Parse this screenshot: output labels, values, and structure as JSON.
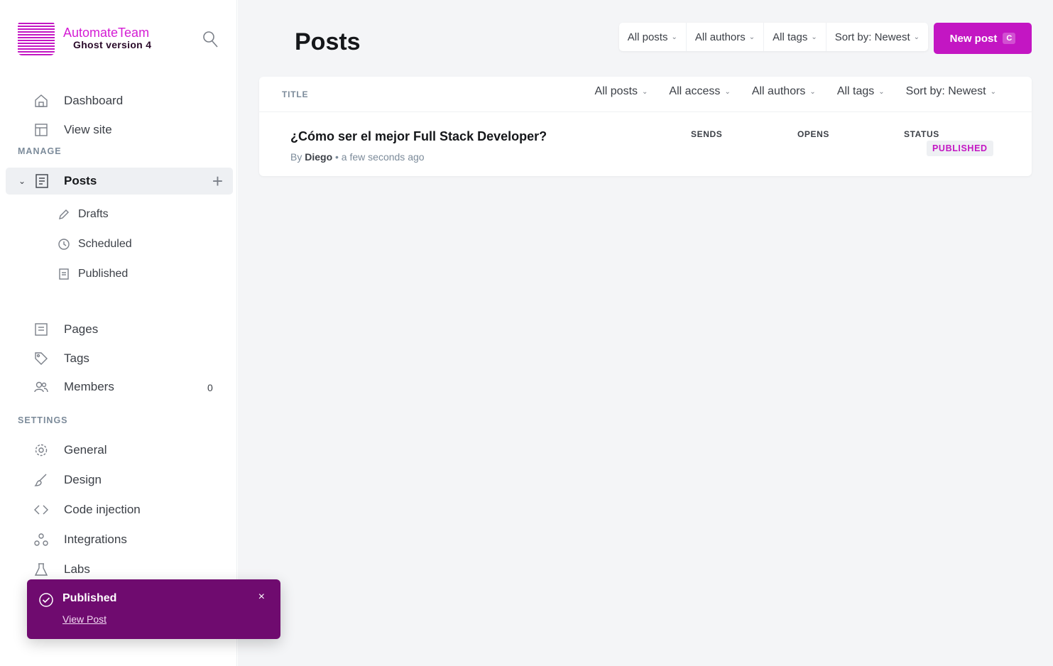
{
  "brand": {
    "name": "AutomateTeam",
    "version": "Ghost version 4"
  },
  "sidebar": {
    "nav_top": [
      {
        "label": "Dashboard",
        "icon": "home-icon"
      },
      {
        "label": "View site",
        "icon": "window-icon"
      }
    ],
    "manage_label": "MANAGE",
    "posts": {
      "label": "Posts",
      "icon": "posts-icon"
    },
    "post_subitems": [
      {
        "label": "Drafts",
        "icon": "pencil-icon"
      },
      {
        "label": "Scheduled",
        "icon": "clock-icon"
      },
      {
        "label": "Published",
        "icon": "published-icon"
      }
    ],
    "manage_items": [
      {
        "label": "Pages",
        "icon": "pages-icon"
      },
      {
        "label": "Tags",
        "icon": "tag-icon"
      },
      {
        "label": "Members",
        "icon": "members-icon",
        "count": "0"
      }
    ],
    "settings_label": "SETTINGS",
    "settings_items": [
      {
        "label": "General",
        "icon": "gear-icon"
      },
      {
        "label": "Design",
        "icon": "brush-icon"
      },
      {
        "label": "Code injection",
        "icon": "code-icon"
      },
      {
        "label": "Integrations",
        "icon": "integrations-icon"
      },
      {
        "label": "Labs",
        "icon": "flask-icon"
      }
    ]
  },
  "main": {
    "title": "Posts",
    "filters": [
      "All posts",
      "All authors",
      "All tags",
      "Sort by: Newest"
    ],
    "new_post": {
      "label": "New post",
      "shortcut": "C"
    },
    "table": {
      "title_header": "TITLE",
      "head_filters": [
        "All posts",
        "All access",
        "All authors",
        "All tags",
        "Sort by: Newest"
      ],
      "columns": {
        "sends": "SENDS",
        "opens": "OPENS",
        "status": "STATUS"
      },
      "rows": [
        {
          "title": "¿Cómo ser el mejor Full Stack Developer?",
          "by": "By",
          "author": "Diego",
          "time": "• a few seconds ago",
          "status": "PUBLISHED"
        }
      ]
    }
  },
  "toast": {
    "title": "Published",
    "link": "View Post",
    "close": "×"
  },
  "colors": {
    "accent": "#c316c3",
    "toast_bg": "#6f0b6f",
    "main_bg": "#f4f5f7"
  }
}
